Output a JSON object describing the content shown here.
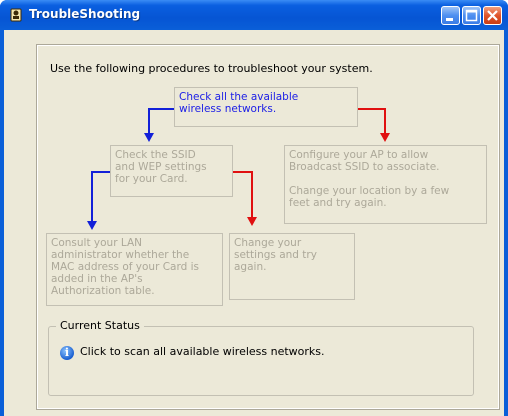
{
  "window": {
    "title": "TroubleShooting",
    "app_icon": "wrench-icon",
    "controls": {
      "minimize": "minimize-icon",
      "maximize": "maximize-icon",
      "close": "close-icon"
    }
  },
  "intro": "Use the following procedures to troubleshoot your system.",
  "steps": {
    "check_networks": [
      "Check all the available",
      "wireless networks."
    ],
    "check_ssid": [
      "Check the SSID",
      "and WEP settings",
      "for your Card."
    ],
    "configure_ap": [
      "Configure your AP to allow",
      "Broadcast SSID to associate."
    ],
    "change_location": [
      "Change your location by a few",
      "feet and try again."
    ],
    "consult_admin": [
      "Consult your LAN",
      "administrator whether the",
      "MAC address of your Card is",
      "added in the AP's",
      "Authorization table."
    ],
    "change_settings": [
      "Change your",
      "settings and try",
      "again."
    ]
  },
  "colors": {
    "blue_arrow": "#1220d8",
    "red_arrow": "#e01010",
    "active_text": "#1e20e6",
    "inactive_text": "#aca899"
  },
  "status": {
    "legend": "Current Status",
    "icon": "info-icon",
    "message": "Click to scan all available wireless networks."
  }
}
